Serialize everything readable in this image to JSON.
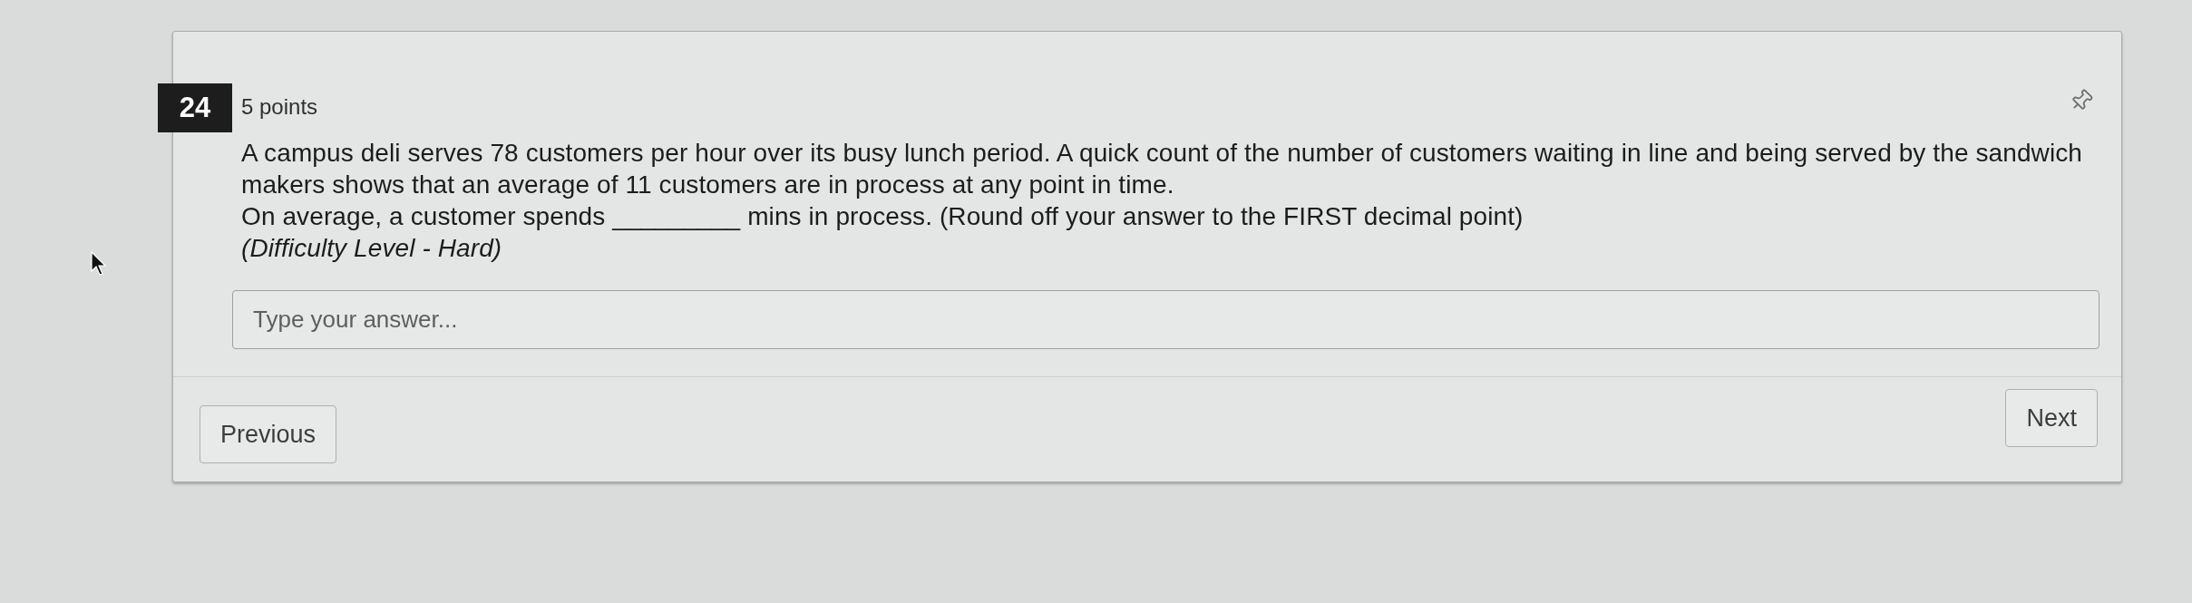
{
  "question": {
    "number": "24",
    "points": "5 points",
    "paragraphs": [
      "A campus deli serves 78 customers per hour over its busy lunch period. A quick count of the number of customers waiting in line and being served by the sandwich makers shows that an average of 11 customers are in process at any point in time.",
      "On average, a customer spends _________ mins in process. (Round off your answer to the FIRST decimal point)"
    ],
    "difficulty": "(Difficulty Level - Hard)"
  },
  "answer": {
    "placeholder": "Type your answer..."
  },
  "navigation": {
    "previous": "Previous",
    "next": "Next"
  }
}
